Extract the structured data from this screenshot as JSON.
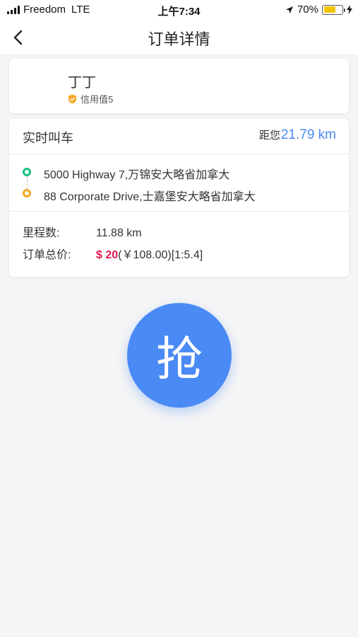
{
  "status_bar": {
    "carrier": "Freedom",
    "network": "LTE",
    "time": "上午7:34",
    "battery_percent": "70%",
    "battery_level": 0.7
  },
  "nav": {
    "title": "订单详情",
    "back_icon": "chevron-left-icon"
  },
  "user": {
    "name": "丁丁",
    "credit": "信用值5",
    "credit_icon": "shield-check-icon"
  },
  "order": {
    "type": "实时叫车",
    "distance_prefix": "距您",
    "distance_value": "21.79 km",
    "start_address": "5000 Highway 7,万锦安大略省加拿大",
    "end_address": "88 Corporate Drive,士嘉堡安大略省加拿大",
    "mileage_label": "里程数:",
    "mileage_value": "11.88 km",
    "price_label": "订单总价:",
    "price_main": "$ 20",
    "price_detail": "(￥108.00)[1:5.4]"
  },
  "grab_button": {
    "label": "抢"
  },
  "colors": {
    "accent": "#4a8af4",
    "price": "#e5184d",
    "start_dot": "#19c37d",
    "end_dot": "#f5a623"
  }
}
